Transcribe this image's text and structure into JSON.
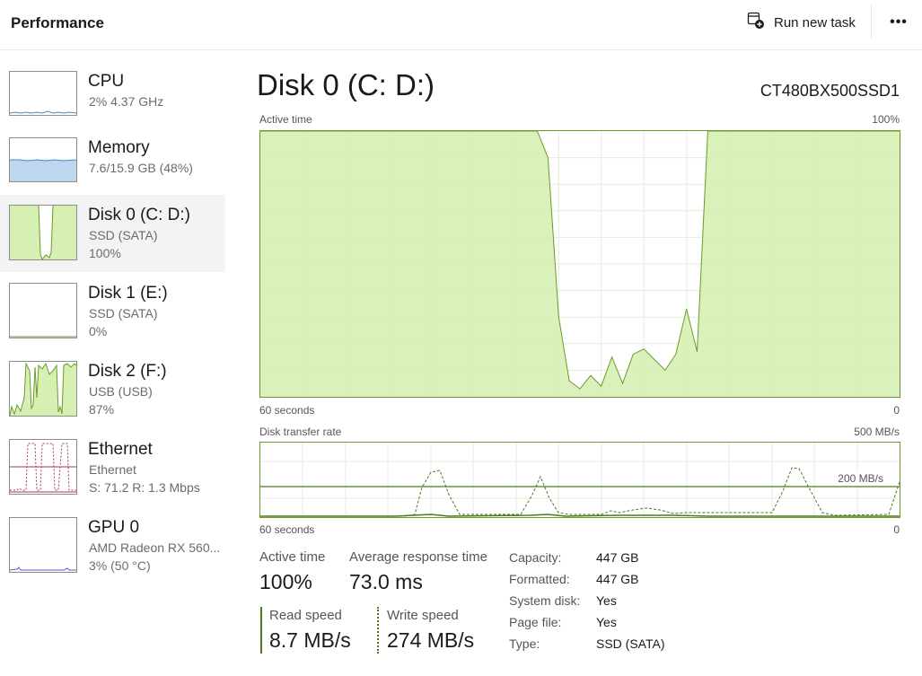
{
  "header": {
    "title": "Performance",
    "run_task_label": "Run new task",
    "more_label": "•••"
  },
  "sidebar": {
    "items": [
      {
        "name": "CPU",
        "line1": "2%  4.37 GHz",
        "line2": "",
        "chart_color": "#3b8ec9"
      },
      {
        "name": "Memory",
        "line1": "7.6/15.9 GB (48%)",
        "line2": "",
        "chart_color": "#3b8ec9"
      },
      {
        "name": "Disk 0 (C: D:)",
        "line1": "SSD (SATA)",
        "line2": "100%",
        "chart_color": "#6a9a2a",
        "selected": true
      },
      {
        "name": "Disk 1 (E:)",
        "line1": "SSD (SATA)",
        "line2": "0%",
        "chart_color": "#6a9a2a"
      },
      {
        "name": "Disk 2 (F:)",
        "line1": "USB (USB)",
        "line2": "87%",
        "chart_color": "#6a9a2a"
      },
      {
        "name": "Ethernet",
        "line1": "Ethernet",
        "line2": "S: 71.2  R: 1.3 Mbps",
        "chart_color": "#a2336b"
      },
      {
        "name": "GPU 0",
        "line1": "AMD Radeon RX 560...",
        "line2": "3%  (50 °C)",
        "chart_color": "#7a4fc4"
      }
    ]
  },
  "main": {
    "title": "Disk 0 (C: D:)",
    "model": "CT480BX500SSD1",
    "active_graph": {
      "label": "Active time",
      "max_label": "100%",
      "time_label": "60 seconds",
      "min_label": "0"
    },
    "transfer_graph": {
      "label": "Disk transfer rate",
      "max_label": "500 MB/s",
      "ref_label": "200 MB/s",
      "time_label": "60 seconds",
      "min_label": "0"
    },
    "stats": {
      "active_time_label": "Active time",
      "active_time_value": "100%",
      "avg_response_label": "Average response time",
      "avg_response_value": "73.0 ms",
      "read_label": "Read speed",
      "read_value": "8.7 MB/s",
      "write_label": "Write speed",
      "write_value": "274 MB/s"
    },
    "properties": [
      {
        "label": "Capacity:",
        "value": "447 GB"
      },
      {
        "label": "Formatted:",
        "value": "447 GB"
      },
      {
        "label": "System disk:",
        "value": "Yes"
      },
      {
        "label": "Page file:",
        "value": "Yes"
      },
      {
        "label": "Type:",
        "value": "SSD (SATA)"
      }
    ]
  },
  "colors": {
    "disk_fill": "#d6f0b4",
    "disk_line": "#6a9a2a",
    "grid": "#e4eed8"
  },
  "chart_data": {
    "type": "area",
    "title": "Active time",
    "x_range": [
      60,
      0
    ],
    "ylim": [
      0,
      100
    ],
    "x": [
      60,
      59,
      58,
      57,
      56,
      55,
      54,
      53,
      52,
      51,
      50,
      49,
      48,
      47,
      46,
      45,
      44,
      43,
      42,
      41,
      40,
      39,
      38,
      37,
      36,
      35,
      34,
      33,
      32,
      31,
      30,
      29,
      28,
      27,
      26,
      25,
      24,
      23,
      22,
      21,
      20,
      19,
      18,
      17,
      16,
      15,
      14,
      13,
      12,
      11,
      10,
      9,
      8,
      7,
      6,
      5,
      4,
      3,
      2,
      1,
      0
    ],
    "series": [
      {
        "values": [
          100,
          100,
          100,
          100,
          100,
          100,
          100,
          100,
          100,
          100,
          100,
          100,
          100,
          100,
          100,
          100,
          100,
          100,
          100,
          100,
          100,
          100,
          100,
          100,
          100,
          100,
          100,
          90,
          30,
          6,
          3,
          8,
          4,
          15,
          5,
          16,
          18,
          14,
          10,
          16,
          33,
          17,
          100,
          100,
          100,
          100,
          100,
          100,
          100,
          100,
          100,
          100,
          100,
          100,
          100,
          100,
          100,
          100,
          100,
          100,
          100
        ]
      }
    ]
  }
}
